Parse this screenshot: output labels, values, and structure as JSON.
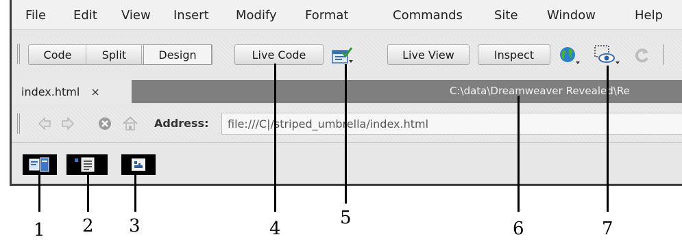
{
  "menu": [
    "File",
    "Edit",
    "View",
    "Insert",
    "Modify",
    "Format",
    "Commands",
    "Site",
    "Window",
    "Help"
  ],
  "document_toolbar": {
    "view_buttons": [
      "Code",
      "Split",
      "Design"
    ],
    "live_code": "Live Code",
    "live_view": "Live View",
    "inspect": "Inspect"
  },
  "document_tab": {
    "filename": "index.html",
    "close": "×",
    "path": "C:\\data\\Dreamweaver Revealed\\Re"
  },
  "browser_nav": {
    "address_label": "Address:",
    "address_value": "file:///C|/striped_umbrella/index.html"
  },
  "callouts": [
    "1",
    "2",
    "3",
    "4",
    "5",
    "6",
    "7"
  ],
  "icons": [
    "related-files-icon",
    "code-navigator-icon",
    "style-rendering-icon",
    "file-management-icon",
    "preview-globe-icon",
    "visual-aids-icon",
    "refresh-icon",
    "back-arrow-icon",
    "forward-arrow-icon",
    "stop-icon",
    "home-icon"
  ]
}
